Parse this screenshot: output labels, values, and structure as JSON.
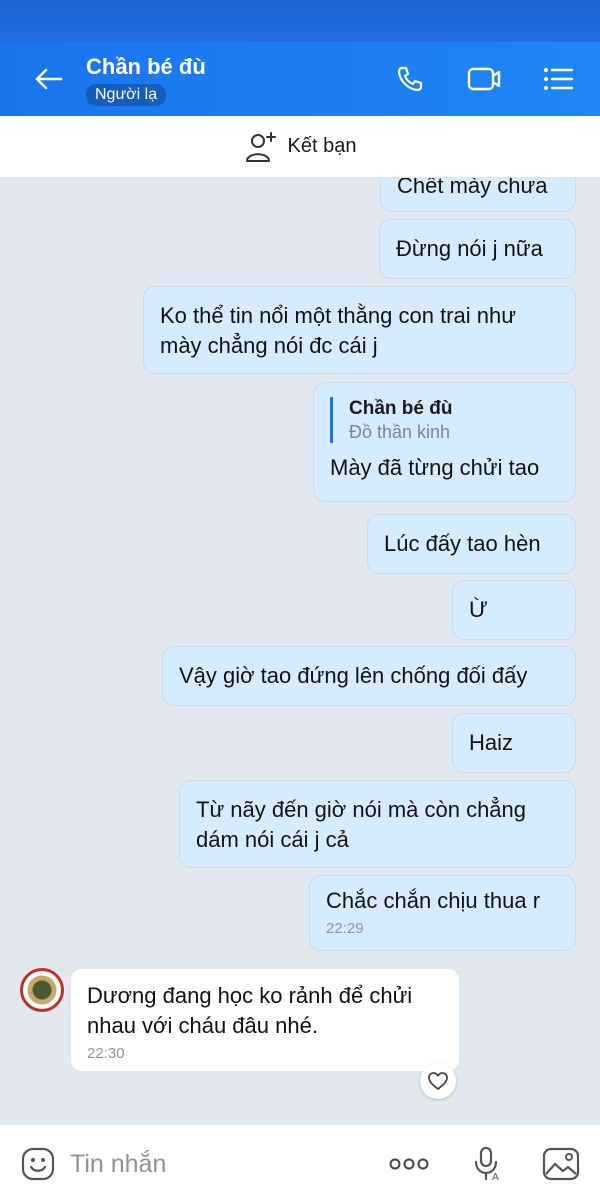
{
  "header": {
    "title": "Chần bé đù",
    "badge": "Người lạ"
  },
  "friend_bar": {
    "label": "Kết bạn"
  },
  "messages": [
    {
      "text": "Chết mày chưa"
    },
    {
      "text": "Đừng nói j nữa"
    },
    {
      "text": "Ko thể tin nổi một thằng con trai như mày chẳng nói đc cái j"
    },
    {
      "reply_to": {
        "name": "Chần bé đù",
        "text": "Đồ thần kinh"
      },
      "text": "Mày đã từng chửi tao"
    },
    {
      "text": "Lúc đấy tao hèn"
    },
    {
      "text": "Ừ"
    },
    {
      "text": "Vậy giờ tao đứng lên chống đối đấy"
    },
    {
      "text": "Haiz"
    },
    {
      "text": "Từ nãy đến giờ nói mà còn chẳng dám nói cái j cả"
    },
    {
      "text": "Chắc chắn chịu thua r",
      "time": "22:29"
    },
    {
      "text": "Dương đang học ko rảnh để chửi nhau với cháu đâu nhé.",
      "time": "22:30",
      "incoming": true
    }
  ],
  "composer": {
    "placeholder": "Tin nhắn"
  },
  "icons": {
    "back": "arrow-left-icon",
    "call": "phone-icon",
    "video": "video-camera-icon",
    "menu": "list-menu-icon",
    "add_friend": "add-user-icon",
    "emoji": "emoji-icon",
    "more": "more-dots-icon",
    "voice": "mic-icon",
    "image": "image-icon",
    "react": "heart-icon"
  },
  "colors": {
    "header": "#1a74f0",
    "outgoing_bubble": "#d6ecfe",
    "incoming_bubble": "#ffffff",
    "background": "#e3e7ee"
  }
}
